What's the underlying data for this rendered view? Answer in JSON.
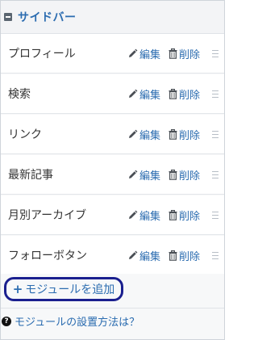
{
  "sidebar": {
    "title": "サイドバー"
  },
  "modules": [
    {
      "label": "プロフィール",
      "edit": "編集",
      "delete": "削除"
    },
    {
      "label": "検索",
      "edit": "編集",
      "delete": "削除"
    },
    {
      "label": "リンク",
      "edit": "編集",
      "delete": "削除"
    },
    {
      "label": "最新記事",
      "edit": "編集",
      "delete": "削除"
    },
    {
      "label": "月別アーカイブ",
      "edit": "編集",
      "delete": "削除"
    },
    {
      "label": "フォローボタン",
      "edit": "編集",
      "delete": "削除"
    }
  ],
  "add_module": {
    "plus": "+",
    "label": "モジュールを追加"
  },
  "help": {
    "icon_text": "?",
    "label": "モジュールの設置方法は？"
  },
  "icons": {
    "edit": "pencil-icon",
    "delete": "trash-icon",
    "drag": "drag-handle-icon",
    "collapse": "collapse-icon",
    "help": "question-circle-icon"
  },
  "colors": {
    "link": "#2b6cb0",
    "highlight_border": "#1a1f8f"
  }
}
